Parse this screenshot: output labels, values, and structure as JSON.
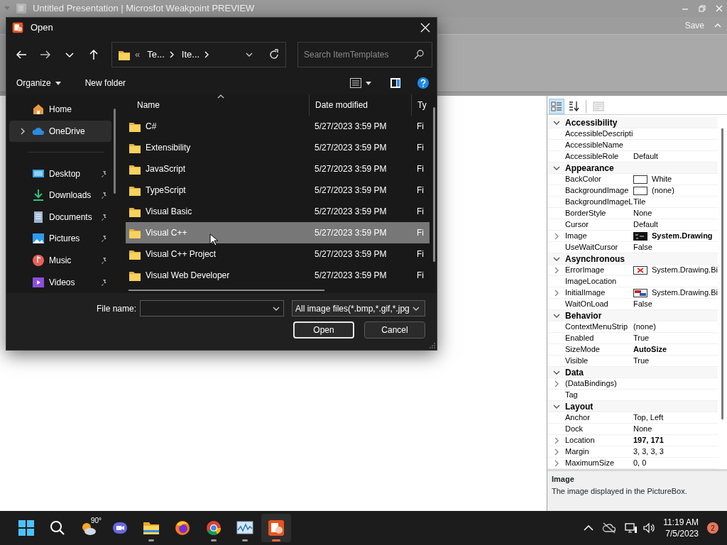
{
  "app": {
    "title": "Untitled Presentation | Microsfot Weakpoint PREVIEW",
    "save": "Save"
  },
  "dialog": {
    "title": "Open",
    "breadcrumb": {
      "overflow": "«",
      "segments": [
        "Te...",
        "Ite..."
      ]
    },
    "search": {
      "placeholder": "Search ItemTemplates"
    },
    "commands": {
      "organize": "Organize",
      "new_folder": "New folder"
    },
    "nav_top": [
      {
        "label": "Home",
        "kind": "home",
        "expandable": false,
        "selected": false
      },
      {
        "label": "OneDrive",
        "kind": "cloud",
        "expandable": true,
        "selected": true
      }
    ],
    "nav_quick": [
      {
        "label": "Desktop",
        "kind": "desktop",
        "pinned": true
      },
      {
        "label": "Downloads",
        "kind": "download",
        "pinned": true
      },
      {
        "label": "Documents",
        "kind": "document",
        "pinned": true
      },
      {
        "label": "Pictures",
        "kind": "pictures",
        "pinned": true
      },
      {
        "label": "Music",
        "kind": "music",
        "pinned": true
      },
      {
        "label": "Videos",
        "kind": "videos",
        "pinned": true
      }
    ],
    "columns": [
      {
        "label": "Name",
        "sorted": true
      },
      {
        "label": "Date modified",
        "sorted": false
      },
      {
        "label": "Ty",
        "sorted": false
      }
    ],
    "rows": [
      {
        "name": "C#",
        "modified": "5/27/2023 3:59 PM",
        "type": "Fi",
        "selected": false
      },
      {
        "name": "Extensibility",
        "modified": "5/27/2023 3:59 PM",
        "type": "Fi",
        "selected": false
      },
      {
        "name": "JavaScript",
        "modified": "5/27/2023 3:59 PM",
        "type": "Fi",
        "selected": false
      },
      {
        "name": "TypeScript",
        "modified": "5/27/2023 3:59 PM",
        "type": "Fi",
        "selected": false
      },
      {
        "name": "Visual Basic",
        "modified": "5/27/2023 3:59 PM",
        "type": "Fi",
        "selected": false
      },
      {
        "name": "Visual C++",
        "modified": "5/27/2023 3:59 PM",
        "type": "Fi",
        "selected": true
      },
      {
        "name": "Visual C++ Project",
        "modified": "5/27/2023 3:59 PM",
        "type": "Fi",
        "selected": false
      },
      {
        "name": "Visual Web Developer",
        "modified": "5/27/2023 3:59 PM",
        "type": "Fi",
        "selected": false
      }
    ],
    "file_name_label": "File name:",
    "filter": "All image files(*.bmp,*.gif,*.jpg",
    "buttons": [
      {
        "label": "Open",
        "default": true
      },
      {
        "label": "Cancel",
        "default": false
      }
    ]
  },
  "properties": {
    "toolbar": [
      {
        "kind": "categorized",
        "selected": true
      },
      {
        "kind": "alphabetical",
        "selected": false
      },
      {
        "kind": "pages",
        "selected": false
      }
    ],
    "categories": [
      {
        "name": "Accessibility",
        "expanded": true,
        "items": [
          {
            "name": "AccessibleDescripti"
          },
          {
            "name": "AccessibleName"
          },
          {
            "name": "AccessibleRole",
            "value": "Default"
          }
        ]
      },
      {
        "name": "Appearance",
        "expanded": true,
        "items": [
          {
            "name": "BackColor",
            "value": "White",
            "kind": "blank"
          },
          {
            "name": "BackgroundImage",
            "value": "(none)",
            "kind": "blank"
          },
          {
            "name": "BackgroundImageL",
            "value": "Tile"
          },
          {
            "name": "BorderStyle",
            "value": "None"
          },
          {
            "name": "Cursor",
            "value": "Default"
          },
          {
            "name": "Image",
            "value": "System.Drawing",
            "kind": "dark",
            "bold": true,
            "expandable": true
          },
          {
            "name": "UseWaitCursor",
            "value": "False"
          }
        ]
      },
      {
        "name": "Asynchronous",
        "expanded": true,
        "items": [
          {
            "name": "ErrorImage",
            "value": "System.Drawing.Bi",
            "kind": "error",
            "expandable": true
          },
          {
            "name": "ImageLocation"
          },
          {
            "name": "InitialImage",
            "value": "System.Drawing.Bi",
            "kind": "image",
            "expandable": true
          },
          {
            "name": "WaitOnLoad",
            "value": "False"
          }
        ]
      },
      {
        "name": "Behavior",
        "expanded": true,
        "items": [
          {
            "name": "ContextMenuStrip",
            "value": "(none)"
          },
          {
            "name": "Enabled",
            "value": "True"
          },
          {
            "name": "SizeMode",
            "value": "AutoSize",
            "bold": true
          },
          {
            "name": "Visible",
            "value": "True"
          }
        ]
      },
      {
        "name": "Data",
        "expanded": true,
        "items": [
          {
            "name": "(DataBindings)",
            "expandable": true
          },
          {
            "name": "Tag"
          }
        ]
      },
      {
        "name": "Layout",
        "expanded": true,
        "items": [
          {
            "name": "Anchor",
            "value": "Top, Left"
          },
          {
            "name": "Dock",
            "value": "None"
          },
          {
            "name": "Location",
            "value": "197, 171",
            "bold": true,
            "expandable": true
          },
          {
            "name": "Margin",
            "value": "3, 3, 3, 3",
            "expandable": true
          },
          {
            "name": "MaximumSize",
            "value": "0, 0",
            "expandable": true
          }
        ]
      }
    ],
    "description": {
      "title": "Image",
      "text": "The image displayed in the PictureBox."
    }
  },
  "taskbar": {
    "apps": [
      {
        "kind": "start",
        "running": false,
        "active": false
      },
      {
        "kind": "search",
        "running": false,
        "active": false
      },
      {
        "kind": "weather",
        "label": "90°",
        "running": false,
        "active": false
      },
      {
        "kind": "chat",
        "running": false,
        "active": false
      },
      {
        "kind": "explorer",
        "running": true,
        "active": false
      },
      {
        "kind": "firefox",
        "running": false,
        "active": false
      },
      {
        "kind": "chrome",
        "running": true,
        "active": false
      },
      {
        "kind": "monitor",
        "running": true,
        "active": false
      },
      {
        "kind": "weakpoint",
        "running": true,
        "active": true
      }
    ],
    "time": "11:19 AM",
    "date": "7/5/2023",
    "notifications": "2"
  }
}
